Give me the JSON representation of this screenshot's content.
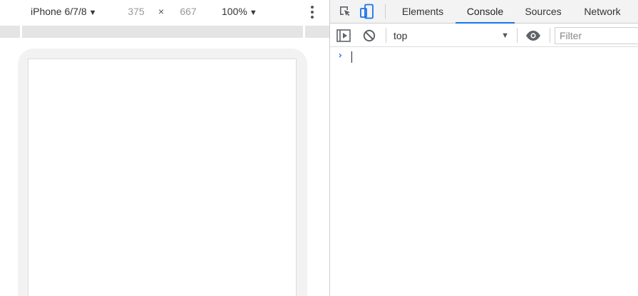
{
  "device_toolbar": {
    "device": "iPhone 6/7/8",
    "width": "375",
    "times": "×",
    "height": "667",
    "zoom": "100%",
    "caret": "▼"
  },
  "devtools": {
    "tabs": [
      {
        "label": "Elements"
      },
      {
        "label": "Console"
      },
      {
        "label": "Sources"
      },
      {
        "label": "Network"
      }
    ],
    "active_tab": "Console",
    "console_toolbar": {
      "context": "top",
      "context_arrow": "▼",
      "filter_placeholder": "Filter"
    },
    "prompt": "›"
  },
  "colors": {
    "accent": "#1a73e8",
    "toolbar_bg": "#f3f3f3",
    "frame": "#f2f2f2"
  }
}
